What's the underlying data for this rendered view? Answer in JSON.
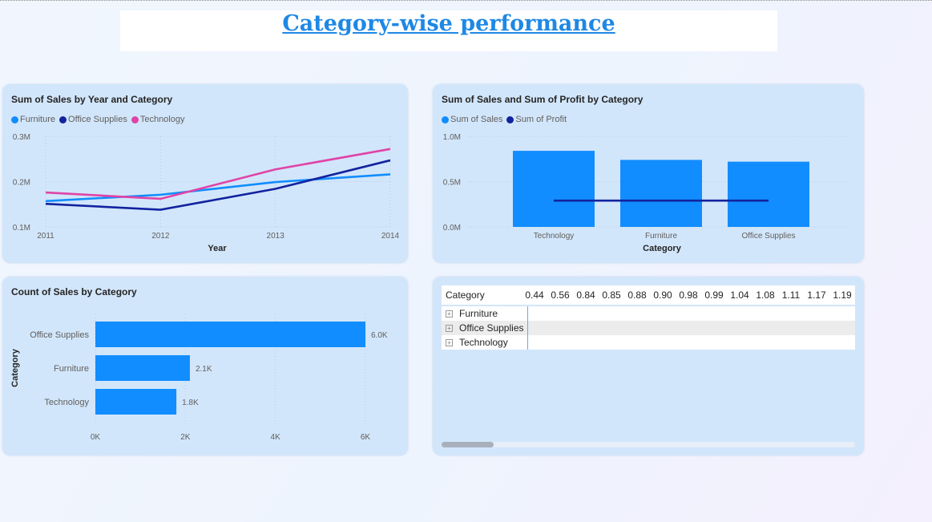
{
  "page_title": "Category-wise performance",
  "colors": {
    "light_blue": "#118dff",
    "navy": "#12239e",
    "magenta": "#e044a7",
    "accent": "#1e88e5"
  },
  "chart_data": [
    {
      "type": "line",
      "title": "Sum of Sales by Year and Category",
      "xlabel": "Year",
      "ylabel": "",
      "x": [
        "2011",
        "2012",
        "2013",
        "2014"
      ],
      "yticks": [
        "0.1M",
        "0.2M",
        "0.3M"
      ],
      "ylim": [
        0.1,
        0.3
      ],
      "legend": "top-left",
      "series": [
        {
          "name": "Furniture",
          "color": "#118dff",
          "values": [
            0.157,
            0.171,
            0.199,
            0.216
          ]
        },
        {
          "name": "Office Supplies",
          "color": "#12239e",
          "values": [
            0.151,
            0.138,
            0.184,
            0.247
          ]
        },
        {
          "name": "Technology",
          "color": "#e044a7",
          "values": [
            0.176,
            0.162,
            0.227,
            0.272
          ]
        }
      ]
    },
    {
      "type": "bar",
      "title": "Sum of Sales and Sum of Profit by Category",
      "xlabel": "Category",
      "categories": [
        "Technology",
        "Furniture",
        "Office Supplies"
      ],
      "yticks": [
        "0.0M",
        "0.5M",
        "1.0M"
      ],
      "ylim": [
        0,
        1.0
      ],
      "legend": "top-left",
      "series": [
        {
          "name": "Sum of Sales",
          "type": "bar",
          "color": "#118dff",
          "values": [
            0.84,
            0.74,
            0.72
          ]
        },
        {
          "name": "Sum of Profit",
          "type": "line",
          "color": "#12239e",
          "values": [
            0.29,
            0.29,
            0.29
          ]
        }
      ]
    },
    {
      "type": "bar",
      "orientation": "horizontal",
      "title": "Count of Sales by Category",
      "ylabel": "Category",
      "categories": [
        "Office Supplies",
        "Furniture",
        "Technology"
      ],
      "values": [
        6.0,
        2.1,
        1.8
      ],
      "data_labels": [
        "6.0K",
        "2.1K",
        "1.8K"
      ],
      "xticks": [
        "0K",
        "2K",
        "4K",
        "6K"
      ],
      "xlim": [
        0,
        6
      ]
    },
    {
      "type": "table",
      "row_header": "Category",
      "columns": [
        "0.44",
        "0.56",
        "0.84",
        "0.85",
        "0.88",
        "0.90",
        "0.98",
        "0.99",
        "1.04",
        "1.08",
        "1.11",
        "1.17",
        "1.19"
      ],
      "rows": [
        "Furniture",
        "Office Supplies",
        "Technology"
      ]
    }
  ]
}
